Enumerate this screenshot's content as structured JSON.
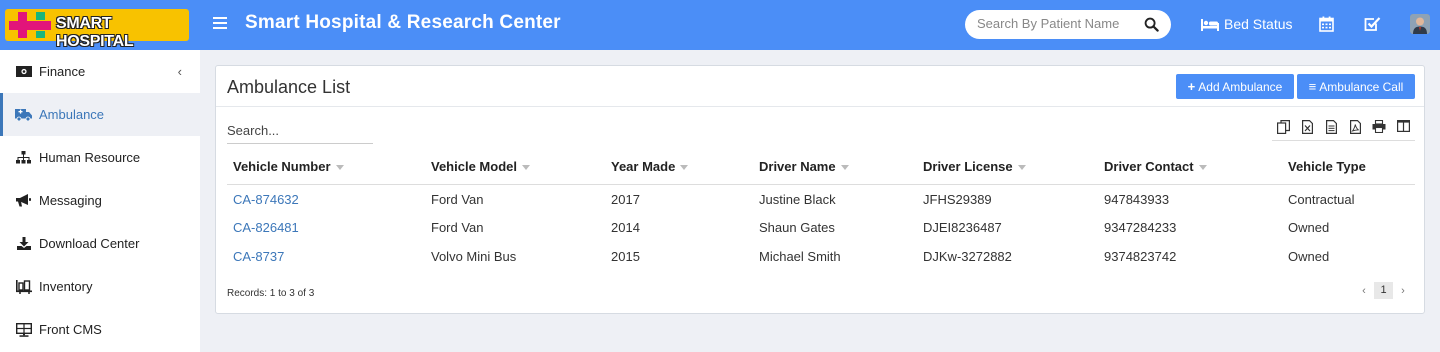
{
  "header": {
    "logo_text": "SMART HOSPITAL",
    "title": "Smart Hospital & Research Center",
    "search_placeholder": "Search By Patient Name",
    "bed_status_label": "Bed Status",
    "icons": [
      "menu-icon",
      "search-icon",
      "bed-icon",
      "calendar-icon",
      "task-check-icon",
      "user-avatar"
    ]
  },
  "sidebar": {
    "items": [
      {
        "label": "Finance",
        "icon": "money-icon",
        "expandable": true
      },
      {
        "label": "Ambulance",
        "icon": "ambulance-icon",
        "active": true
      },
      {
        "label": "Human Resource",
        "icon": "sitemap-icon"
      },
      {
        "label": "Messaging",
        "icon": "bullhorn-icon"
      },
      {
        "label": "Download Center",
        "icon": "download-icon"
      },
      {
        "label": "Inventory",
        "icon": "inventory-icon"
      },
      {
        "label": "Front CMS",
        "icon": "cms-icon"
      }
    ]
  },
  "card": {
    "title": "Ambulance List",
    "add_button_label": "Add Ambulance",
    "call_button_label": "Ambulance Call",
    "search_placeholder": "Search...",
    "toolbar_icons": [
      "copy-icon",
      "excel-icon",
      "csv-icon",
      "pdf-icon",
      "print-icon",
      "columns-icon"
    ]
  },
  "table": {
    "columns": [
      "Vehicle Number",
      "Vehicle Model",
      "Year Made",
      "Driver Name",
      "Driver License",
      "Driver Contact",
      "Vehicle Type"
    ],
    "rows": [
      [
        "CA-874632",
        "Ford Van",
        "2017",
        "Justine Black",
        "JFHS29389",
        "947843933",
        "Contractual"
      ],
      [
        "CA-826481",
        "Ford Van",
        "2014",
        "Shaun Gates",
        "DJEI8236487",
        "9347284233",
        "Owned"
      ],
      [
        "CA-8737",
        "Volvo Mini Bus",
        "2015",
        "Michael Smith",
        "DJKw-3272882",
        "9374823742",
        "Owned"
      ]
    ]
  },
  "footer": {
    "records_text": "Records: 1 to 3 of 3",
    "prev_label": "‹",
    "page": "1",
    "next_label": "›"
  },
  "colors": {
    "header_bg": "#4b8ef7",
    "accent_link": "#3c77b9",
    "page_bg": "#eef0f5",
    "logo_bg": "#f8c200"
  }
}
